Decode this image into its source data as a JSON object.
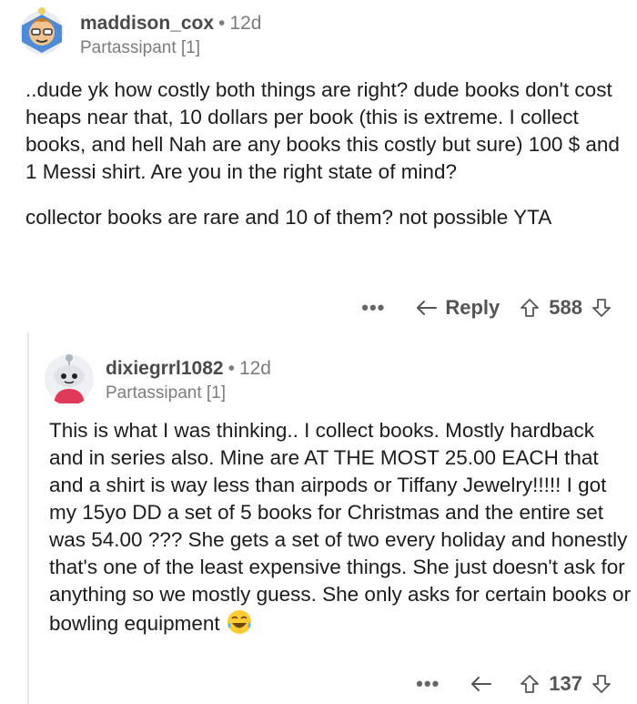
{
  "comments": [
    {
      "username": "maddison_cox",
      "age": "12d",
      "flair": "Partassipant [1]",
      "paragraphs": [
        "..dude yk how costly both things are right? dude books don't cost heaps near that, 10 dollars per book (this is extreme. I collect books, and hell Nah are any books this costly but sure) 100 $ and 1 Messi shirt. Are you in the right state of mind?",
        "collector books are rare and 10 of them? not possible YTA"
      ],
      "more_label": "•••",
      "reply_label": "Reply",
      "score": "588"
    },
    {
      "username": "dixiegrrl1082",
      "age": "12d",
      "flair": "Partassipant [1]",
      "paragraphs": [
        "This is what I was thinking.. I collect books. Mostly hardback and in series also. Mine are AT THE MOST 25.00 EACH that and a shirt is way less than airpods or Tiffany Jewelry!!!!! I got my 15yo DD a set of 5 books for Christmas and the entire set was 54.00 ??? She gets a set of two every holiday and honestly that's one of the least expensive things. She just doesn't ask for anything so we mostly guess. She only asks for certain books or bowling equipment"
      ],
      "emoji": "laughing-tears-emoji",
      "more_label": "•••",
      "score": "137"
    }
  ],
  "icons": {
    "reply": "reply-arrow-icon",
    "upvote": "upvote-arrow-icon",
    "downvote": "downvote-arrow-icon"
  },
  "colors": {
    "text": "#1c1c1c",
    "meta": "#7c7c7c",
    "thread_line": "#e8e8e8"
  }
}
